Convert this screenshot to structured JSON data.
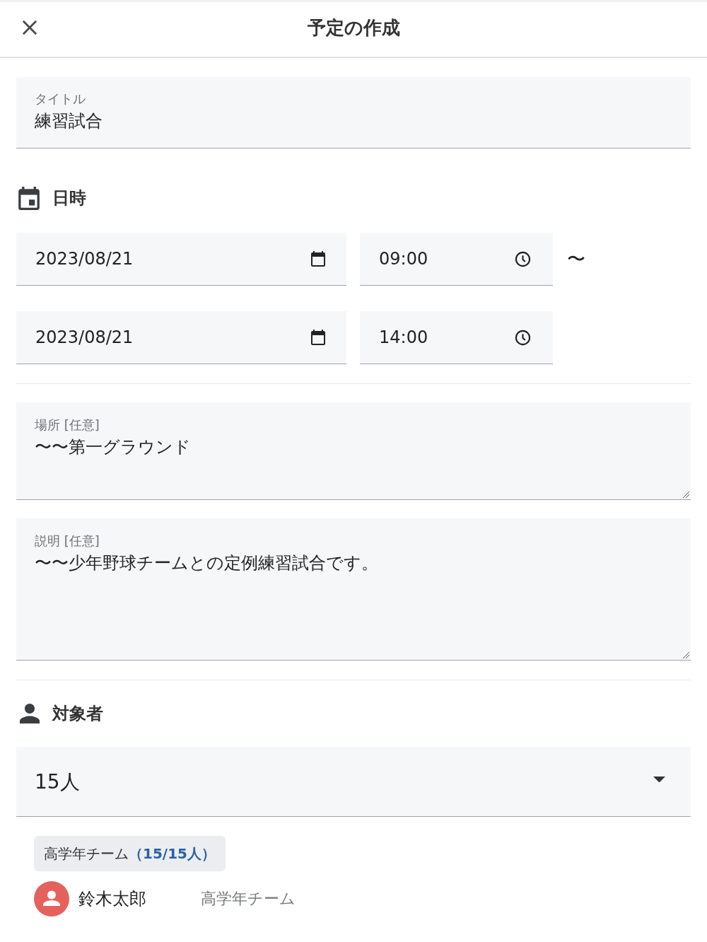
{
  "header": {
    "title": "予定の作成"
  },
  "title_field": {
    "label": "タイトル",
    "value": "練習試合"
  },
  "datetime_section": {
    "heading": "日時",
    "rows": [
      {
        "date": "2023/08/21",
        "time": "09:00",
        "separator": "〜"
      },
      {
        "date": "2023/08/21",
        "time": "14:00"
      }
    ]
  },
  "location_field": {
    "label": "場所 [任意]",
    "value": "〜〜第一グラウンド"
  },
  "description_field": {
    "label": "説明 [任意]",
    "value": "〜〜少年野球チームとの定例練習試合です。"
  },
  "audience_section": {
    "heading": "対象者",
    "select": {
      "value": "15人"
    },
    "groups": [
      {
        "label": "高学年チーム**（15/15人）**",
        "members": [
          {
            "name": "鈴木太郎",
            "team": "高学年チーム"
          }
        ]
      }
    ]
  }
}
